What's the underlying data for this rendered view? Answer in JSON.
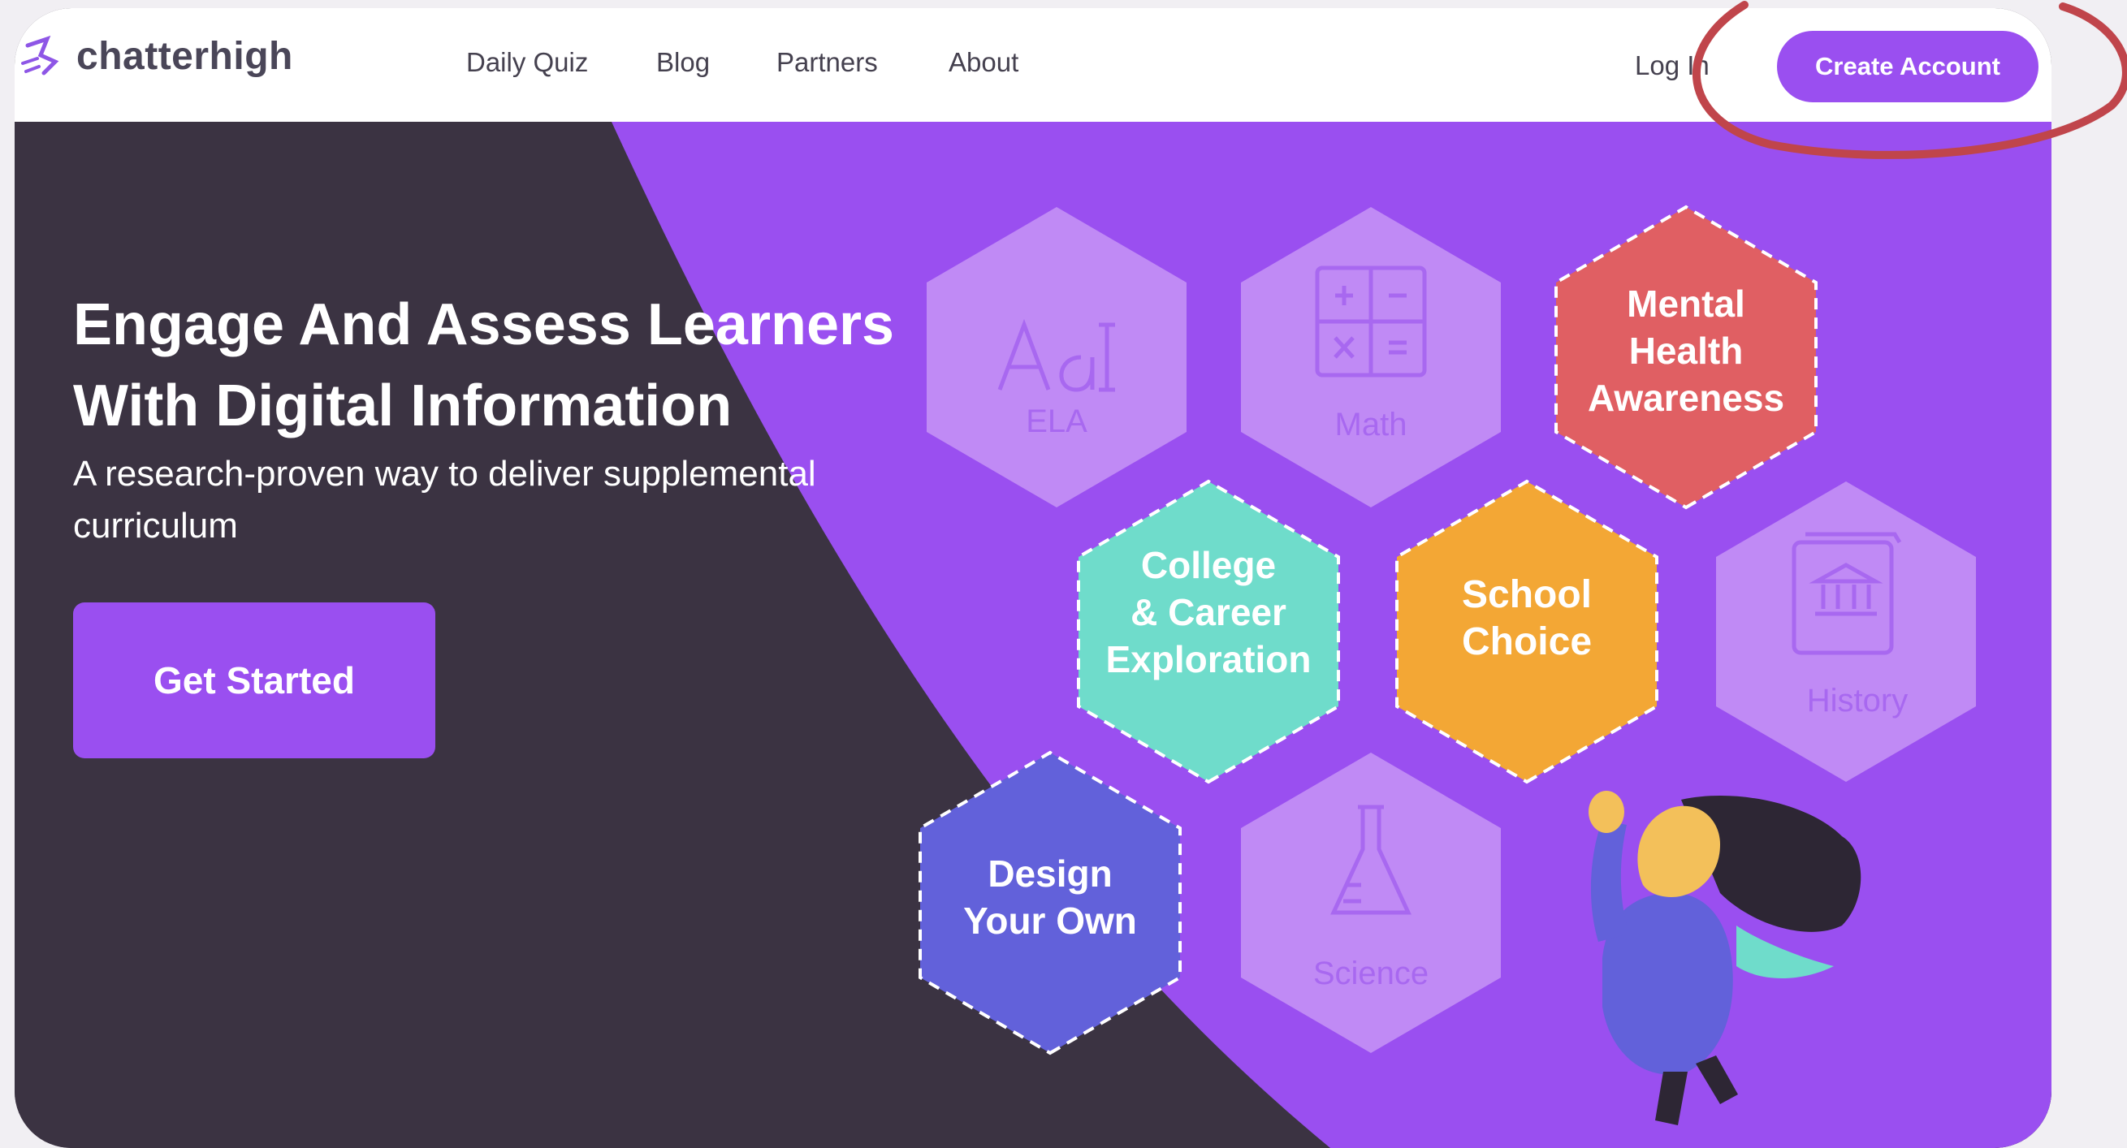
{
  "brand": {
    "name": "chatterhigh",
    "logo_icon": "runner-icon"
  },
  "nav": {
    "links": [
      "Daily Quiz",
      "Blog",
      "Partners",
      "About"
    ],
    "login": "Log In",
    "create_account": "Create Account"
  },
  "hero": {
    "title": "Engage And Assess Learners With Digital Information",
    "subtitle": "A research-proven way to deliver supplemental curriculum",
    "cta": "Get Started"
  },
  "topics": [
    {
      "lines": [
        "ELA"
      ],
      "icon": "text-size-icon",
      "color": "#c08af5",
      "active": false
    },
    {
      "lines": [
        "Math"
      ],
      "icon": "calculator-icon",
      "color": "#c08af5",
      "active": false
    },
    {
      "lines": [
        "Mental",
        "Health",
        "Awareness"
      ],
      "icon": "",
      "color": "#e05f63",
      "active": true
    },
    {
      "lines": [
        "College",
        "& Career",
        "Exploration"
      ],
      "icon": "",
      "color": "#6fdccb",
      "active": true
    },
    {
      "lines": [
        "School",
        "Choice"
      ],
      "icon": "",
      "color": "#f3a735",
      "active": true
    },
    {
      "lines": [
        "History"
      ],
      "icon": "history-book-icon",
      "color": "#c08af5",
      "active": false
    },
    {
      "lines": [
        "Design",
        "Your Own"
      ],
      "icon": "",
      "color": "#6261da",
      "active": true
    },
    {
      "lines": [
        "Science"
      ],
      "icon": "flask-icon",
      "color": "#c08af5",
      "active": false
    }
  ],
  "colors": {
    "accent": "#9a4ff0",
    "dark_bg": "#3b3342",
    "purple_bg": "#9a4ff0",
    "annotation": "#c0454b"
  }
}
